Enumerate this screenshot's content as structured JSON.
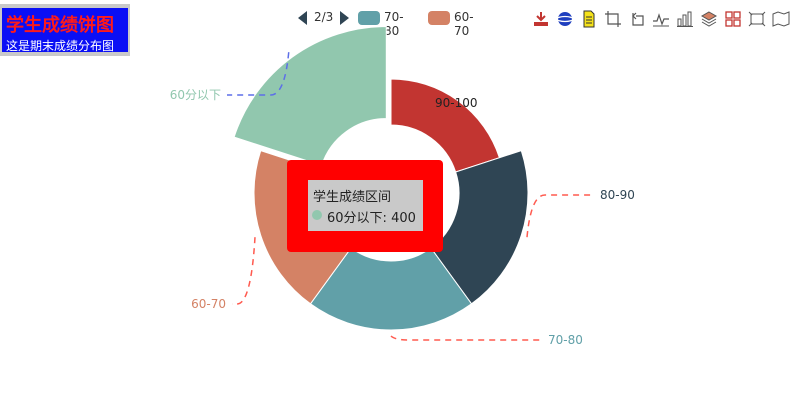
{
  "title": {
    "text": "学生成绩饼图",
    "subtext": "这是期末成绩分布图"
  },
  "legend": {
    "page": "2/3",
    "items": [
      {
        "label": "70-80",
        "color": "#61a0a8"
      },
      {
        "label": "60-70",
        "color": "#d48265"
      }
    ]
  },
  "toolbox": {
    "icons": [
      "save-image-icon",
      "data-globe-icon",
      "data-view-icon",
      "crop-icon",
      "rotate-icon",
      "line-chart-icon",
      "bar-chart-icon",
      "stack-icon",
      "tiled-icon",
      "restore-icon",
      "map-icon"
    ]
  },
  "tooltip": {
    "title": "学生成绩区间",
    "series_name": "60分以下",
    "value": "400",
    "color": "#91c7ae"
  },
  "chart_data": {
    "type": "pie",
    "variant": "rose-donut",
    "series": [
      {
        "name": "90-100",
        "value": 200,
        "color": "#c23531",
        "label_position": "inside"
      },
      {
        "name": "80-90",
        "value": 300,
        "color": "#2f4554",
        "label_position": "outside"
      },
      {
        "name": "70-80",
        "value": 300,
        "color": "#61a0a8",
        "label_position": "outside"
      },
      {
        "name": "60-70",
        "value": 300,
        "color": "#d48265",
        "label_position": "outside"
      },
      {
        "name": "60分以下",
        "value": 400,
        "color": "#91c7ae",
        "label_position": "outside",
        "highlighted": true
      }
    ]
  }
}
